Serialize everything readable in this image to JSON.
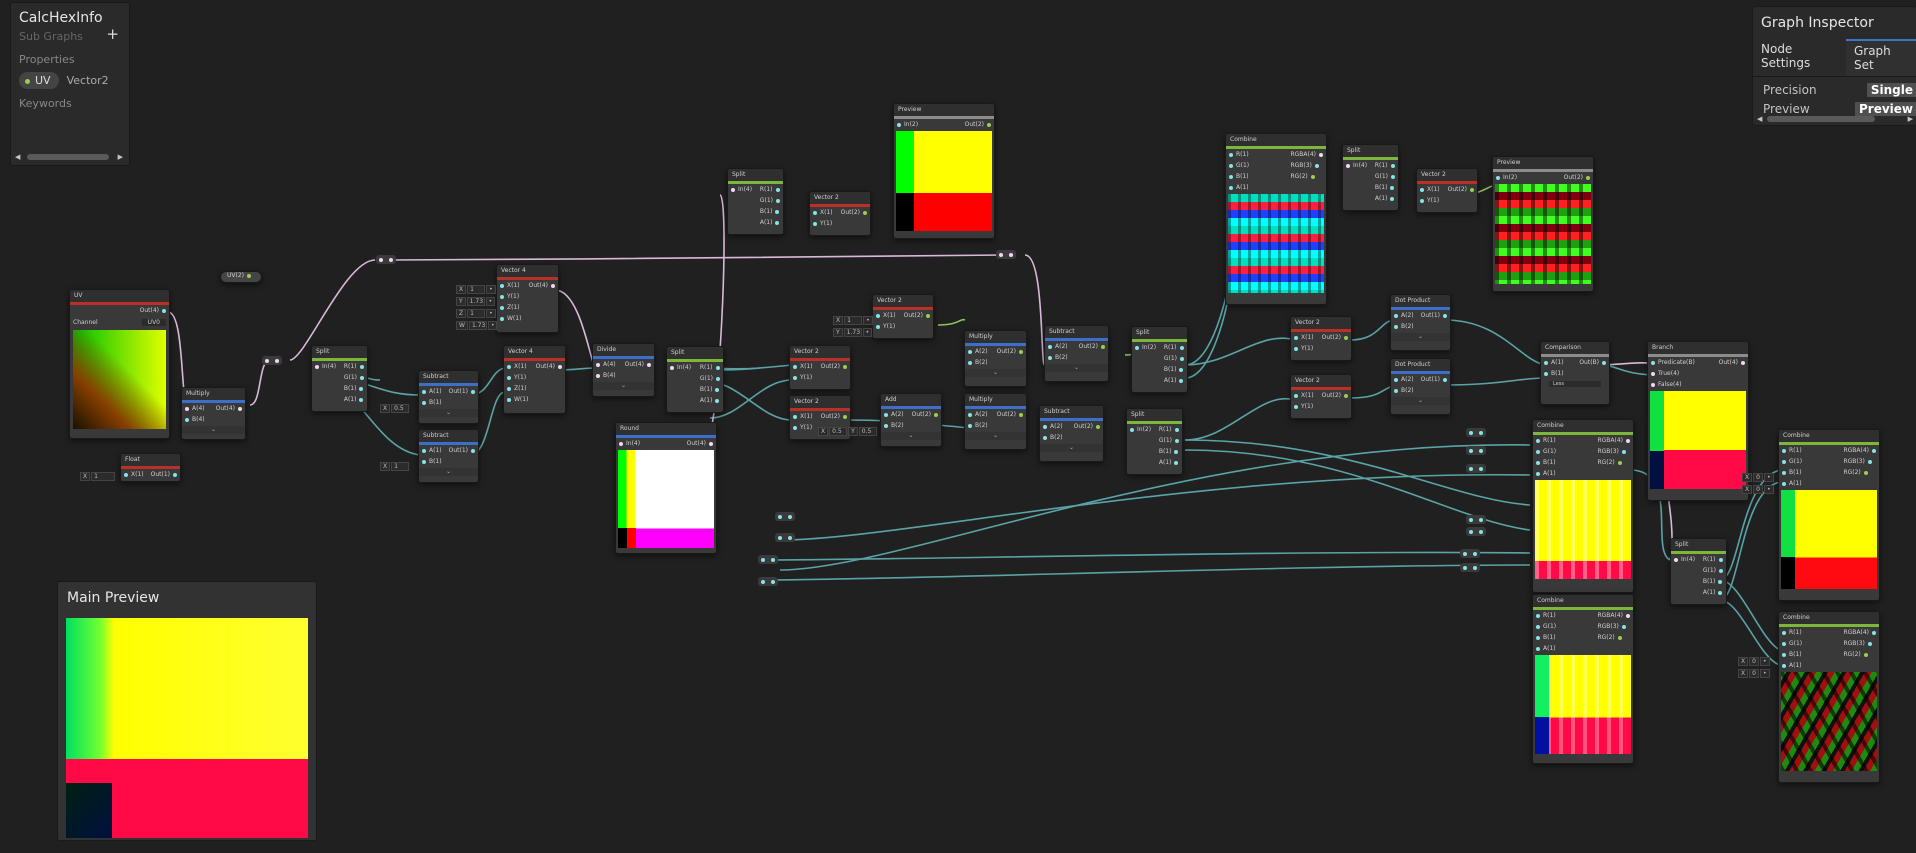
{
  "blackboard": {
    "title": "CalcHexInfo",
    "subtitle": "Sub Graphs",
    "add_label": "+",
    "properties_label": "Properties",
    "property": {
      "name": "UV",
      "type": "Vector2"
    },
    "keywords_label": "Keywords"
  },
  "inspector": {
    "title": "Graph Inspector",
    "tabs": [
      "Node Settings",
      "Graph Settings"
    ],
    "tab_visible": [
      "Node Settings",
      "Graph Set"
    ],
    "rows": [
      {
        "label": "Precision",
        "value": "Single"
      },
      {
        "label": "Preview",
        "value": "Preview"
      }
    ]
  },
  "main_preview": {
    "title": "Main Preview"
  },
  "property_node": {
    "label": "UV(2)"
  },
  "nodes": {
    "uv": {
      "title": "UV",
      "out": "Out(4)",
      "channel_label": "Channel",
      "channel_value": "UV0"
    },
    "float": {
      "title": "Float",
      "in": "X(1)",
      "out": "Out(1)",
      "x_label": "X",
      "x_value": "1"
    },
    "multiply1": {
      "title": "Multiply",
      "a": "A(4)",
      "b": "B(4)",
      "out": "Out(4)"
    },
    "split1": {
      "title": "Split",
      "in": "In(4)",
      "outs": [
        "R(1)",
        "G(1)",
        "B(1)",
        "A(1)"
      ]
    },
    "vector4a": {
      "title": "Vector 4",
      "ins": [
        "X(1)",
        "Y(1)",
        "Z(1)",
        "W(1)"
      ],
      "out": "Out(4)",
      "values": [
        {
          "k": "X",
          "v": "1"
        },
        {
          "k": "Y",
          "v": "1.73"
        },
        {
          "k": "Z",
          "v": "1"
        },
        {
          "k": "W",
          "v": "1.73"
        }
      ]
    },
    "subtract1": {
      "title": "Subtract",
      "a": "A(1)",
      "b": "B(1)",
      "out": "Out(1)",
      "b_label": "X",
      "b_value": "0.5"
    },
    "subtract2": {
      "title": "Subtract",
      "a": "A(1)",
      "b": "B(1)",
      "out": "Out(1)",
      "b_label": "X",
      "b_value": "1"
    },
    "vector4b": {
      "title": "Vector 4",
      "ins": [
        "X(1)",
        "Y(1)",
        "Z(1)",
        "W(1)"
      ],
      "out": "Out(4)"
    },
    "divide": {
      "title": "Divide",
      "a": "A(4)",
      "b": "B(4)",
      "out": "Out(4)"
    },
    "round": {
      "title": "Round",
      "in": "In(4)",
      "out": "Out(4)"
    },
    "split2": {
      "title": "Split",
      "in": "In(4)",
      "outs": [
        "R(1)",
        "G(1)",
        "B(1)",
        "A(1)"
      ]
    },
    "split3": {
      "title": "Split",
      "in": "In(4)",
      "outs": [
        "R(1)",
        "G(1)",
        "B(1)",
        "A(1)"
      ]
    },
    "vector2a": {
      "title": "Vector 2",
      "ins": [
        "X(1)",
        "Y(1)"
      ],
      "out": "Out(2)"
    },
    "preview1": {
      "title": "Preview",
      "in": "In(2)",
      "out": "Out(2)"
    },
    "vector2b": {
      "title": "Vector 2",
      "ins": [
        "X(1)",
        "Y(1)"
      ],
      "out": "Out(2)",
      "values": [
        {
          "k": "X",
          "v": "1"
        },
        {
          "k": "Y",
          "v": "1.73"
        }
      ]
    },
    "vector2c": {
      "title": "Vector 2",
      "ins": [
        "X(1)",
        "Y(1)"
      ],
      "out": "Out(2)"
    },
    "vector2d": {
      "title": "Vector 2",
      "ins": [
        "X(1)",
        "Y(1)"
      ],
      "out": "Out(2)",
      "values": [
        {
          "k": "X",
          "v": "0.5"
        },
        {
          "k": "Y",
          "v": "0.5"
        }
      ]
    },
    "add": {
      "title": "Add",
      "a": "A(2)",
      "b": "B(2)",
      "out": "Out(2)"
    },
    "multiply2": {
      "title": "Multiply",
      "a": "A(2)",
      "b": "B(2)",
      "out": "Out(2)"
    },
    "multiply3": {
      "title": "Multiply",
      "a": "A(2)",
      "b": "B(2)",
      "out": "Out(2)"
    },
    "subtract3": {
      "title": "Subtract",
      "a": "A(2)",
      "b": "B(2)",
      "out": "Out(2)"
    },
    "subtract4": {
      "title": "Subtract",
      "a": "A(2)",
      "b": "B(2)",
      "out": "Out(2)"
    },
    "split4": {
      "title": "Split",
      "in": "In(2)",
      "outs": [
        "R(1)",
        "G(1)",
        "B(1)",
        "A(1)"
      ]
    },
    "split5": {
      "title": "Split",
      "in": "In(2)",
      "outs": [
        "R(1)",
        "G(1)",
        "B(1)",
        "A(1)"
      ]
    },
    "combine1": {
      "title": "Combine",
      "ins": [
        "R(1)",
        "G(1)",
        "B(1)",
        "A(1)"
      ],
      "outs": [
        "RGBA(4)",
        "RGB(3)",
        "RG(2)"
      ]
    },
    "split6": {
      "title": "Split",
      "in": "In(4)",
      "outs": [
        "R(1)",
        "G(1)",
        "B(1)",
        "A(1)"
      ]
    },
    "vector2e": {
      "title": "Vector 2",
      "ins": [
        "X(1)",
        "Y(1)"
      ],
      "out": "Out(2)"
    },
    "preview2": {
      "title": "Preview",
      "in": "In(2)",
      "out": "Out(2)"
    },
    "vector2f": {
      "title": "Vector 2",
      "ins": [
        "X(1)",
        "Y(1)"
      ],
      "out": "Out(2)"
    },
    "vector2g": {
      "title": "Vector 2",
      "ins": [
        "X(1)",
        "Y(1)"
      ],
      "out": "Out(2)"
    },
    "dot1": {
      "title": "Dot Product",
      "a": "A(2)",
      "b": "B(2)",
      "out": "Out(1)"
    },
    "dot2": {
      "title": "Dot Product",
      "a": "A(2)",
      "b": "B(2)",
      "out": "Out(1)"
    },
    "comparison": {
      "title": "Comparison",
      "a": "A(1)",
      "b": "B(1)",
      "out": "Out(B)",
      "mode": "Less"
    },
    "branch": {
      "title": "Branch",
      "ins": [
        "Predicate(B)",
        "True(4)",
        "False(4)"
      ],
      "out": "Out(4)"
    },
    "combine2": {
      "title": "Combine",
      "ins": [
        "R(1)",
        "G(1)",
        "B(1)",
        "A(1)"
      ],
      "outs": [
        "RGBA(4)",
        "RGB(3)",
        "RG(2)"
      ]
    },
    "combine3": {
      "title": "Combine",
      "ins": [
        "R(1)",
        "G(1)",
        "B(1)",
        "A(1)"
      ],
      "outs": [
        "RGBA(4)",
        "RGB(3)",
        "RG(2)"
      ]
    },
    "split7": {
      "title": "Split",
      "in": "In(4)",
      "outs": [
        "R(1)",
        "G(1)",
        "B(1)",
        "A(1)"
      ]
    },
    "combine4": {
      "title": "Combine",
      "ins": [
        "R(1)",
        "G(1)",
        "B(1)",
        "A(1)"
      ],
      "outs": [
        "RGBA(4)",
        "RGB(3)",
        "RG(2)"
      ]
    },
    "combine5": {
      "title": "Combine",
      "ins": [
        "R(1)",
        "G(1)",
        "B(1)",
        "A(1)"
      ],
      "outs": [
        "RGBA(4)",
        "RGB(3)",
        "RG(2)"
      ],
      "values": [
        {
          "k": "X",
          "v": "0"
        },
        {
          "k": "X",
          "v": "0"
        }
      ]
    },
    "combine4_values": [
      {
        "k": "X",
        "v": "0"
      },
      {
        "k": "X",
        "v": "0"
      }
    ]
  }
}
